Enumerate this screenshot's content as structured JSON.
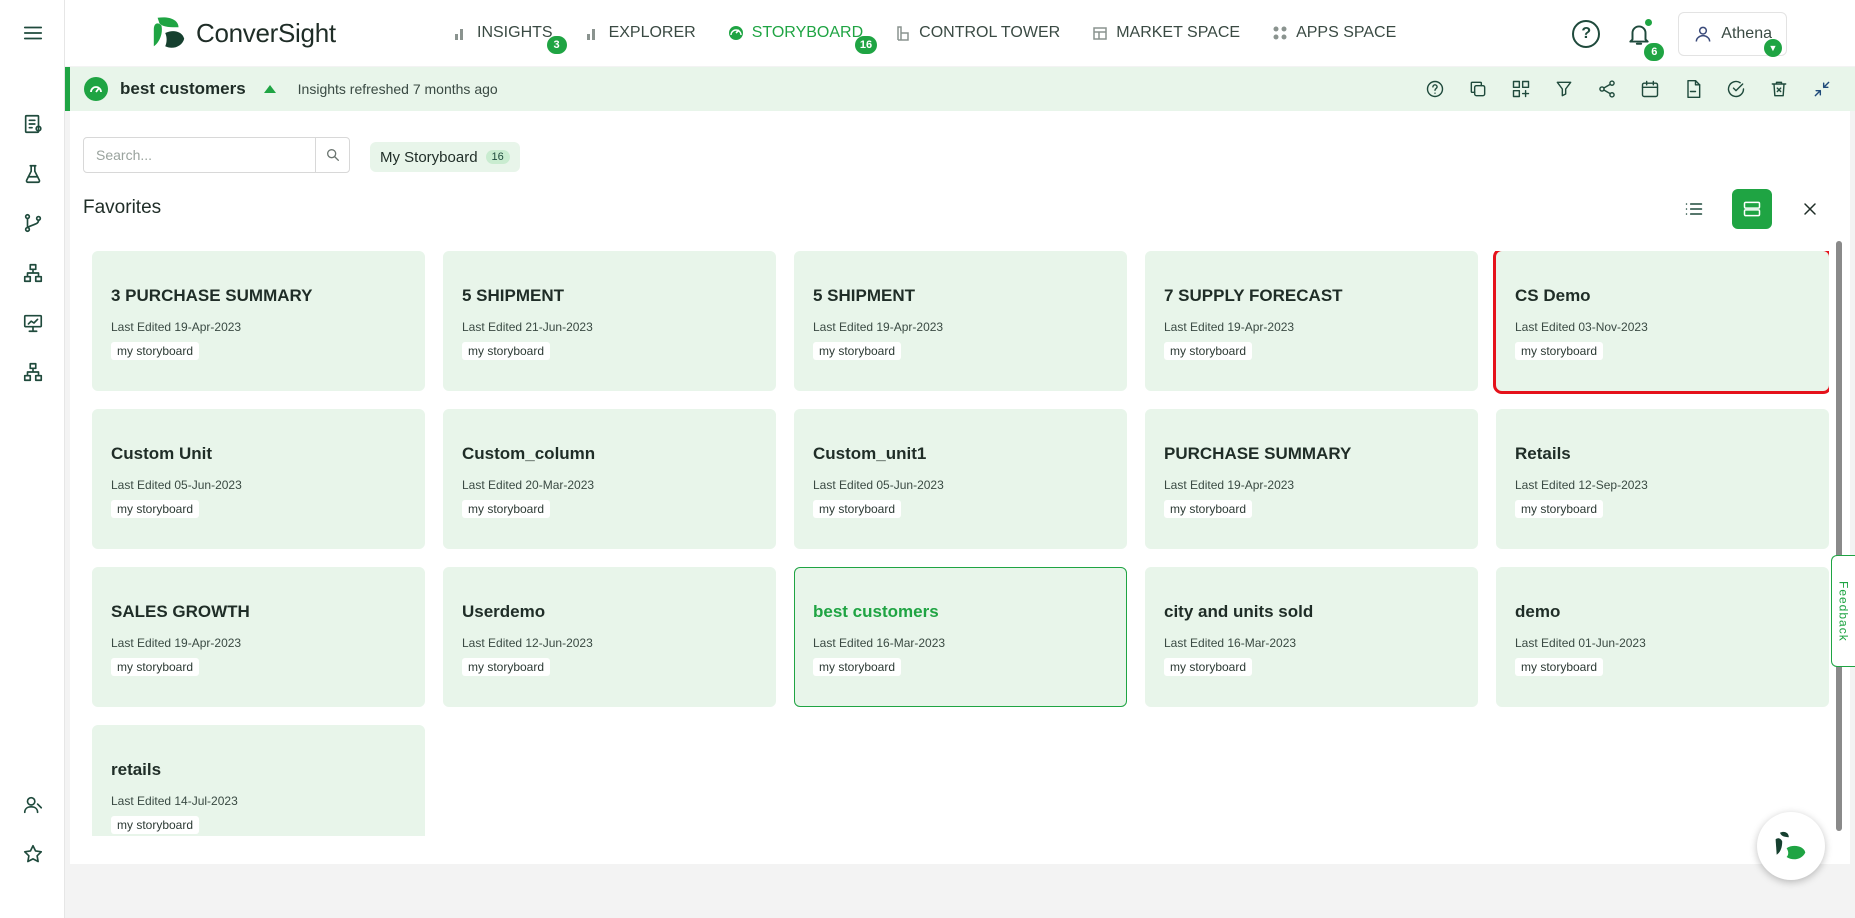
{
  "app": {
    "logo_text": "ConverSight"
  },
  "nav": [
    {
      "label": "INSIGHTS",
      "badge": "3",
      "icon": "bar-chart-icon",
      "active": false
    },
    {
      "label": "EXPLORER",
      "badge": "",
      "icon": "bar-chart-icon",
      "active": false
    },
    {
      "label": "STORYBOARD",
      "badge": "16",
      "icon": "gauge-icon",
      "active": true
    },
    {
      "label": "CONTROL TOWER",
      "badge": "",
      "icon": "tower-icon",
      "active": false
    },
    {
      "label": "MARKET SPACE",
      "badge": "",
      "icon": "market-icon",
      "active": false
    },
    {
      "label": "APPS SPACE",
      "badge": "",
      "icon": "apps-icon",
      "active": false
    }
  ],
  "header": {
    "help": "?",
    "notifications_count": "6",
    "user_name": "Athena"
  },
  "storyboard": {
    "name": "best customers",
    "refreshed": "Insights refreshed 7 months ago"
  },
  "search": {
    "placeholder": "Search..."
  },
  "filter_chip": {
    "label": "My Storyboard",
    "count": "16"
  },
  "section_title": "Favorites",
  "feedback_label": "Feedback",
  "cards": [
    {
      "title": "3 PURCHASE SUMMARY",
      "date": "Last Edited 19-Apr-2023",
      "tag": "my storyboard"
    },
    {
      "title": "5 SHIPMENT",
      "date": "Last Edited 21-Jun-2023",
      "tag": "my storyboard"
    },
    {
      "title": "5 SHIPMENT",
      "date": "Last Edited 19-Apr-2023",
      "tag": "my storyboard"
    },
    {
      "title": "7 SUPPLY FORECAST",
      "date": "Last Edited 19-Apr-2023",
      "tag": "my storyboard"
    },
    {
      "title": "CS Demo",
      "date": "Last Edited 03-Nov-2023",
      "tag": "my storyboard",
      "selected": true
    },
    {
      "title": "Custom Unit",
      "date": "Last Edited 05-Jun-2023",
      "tag": "my storyboard"
    },
    {
      "title": "Custom_column",
      "date": "Last Edited 20-Mar-2023",
      "tag": "my storyboard"
    },
    {
      "title": "Custom_unit1",
      "date": "Last Edited 05-Jun-2023",
      "tag": "my storyboard"
    },
    {
      "title": "PURCHASE SUMMARY",
      "date": "Last Edited 19-Apr-2023",
      "tag": "my storyboard"
    },
    {
      "title": "Retails",
      "date": "Last Edited 12-Sep-2023",
      "tag": "my storyboard"
    },
    {
      "title": "SALES GROWTH",
      "date": "Last Edited 19-Apr-2023",
      "tag": "my storyboard"
    },
    {
      "title": "Userdemo",
      "date": "Last Edited 12-Jun-2023",
      "tag": "my storyboard"
    },
    {
      "title": "best customers",
      "date": "Last Edited 16-Mar-2023",
      "tag": "my storyboard",
      "current": true
    },
    {
      "title": "city and units sold",
      "date": "Last Edited 16-Mar-2023",
      "tag": "my storyboard"
    },
    {
      "title": "demo",
      "date": "Last Edited 01-Jun-2023",
      "tag": "my storyboard"
    },
    {
      "title": "retails",
      "date": "Last Edited 14-Jul-2023",
      "tag": "my storyboard"
    }
  ],
  "colors": {
    "accent": "#1fa443",
    "card_bg": "#e8f5ea",
    "selection": "#e5121b"
  }
}
